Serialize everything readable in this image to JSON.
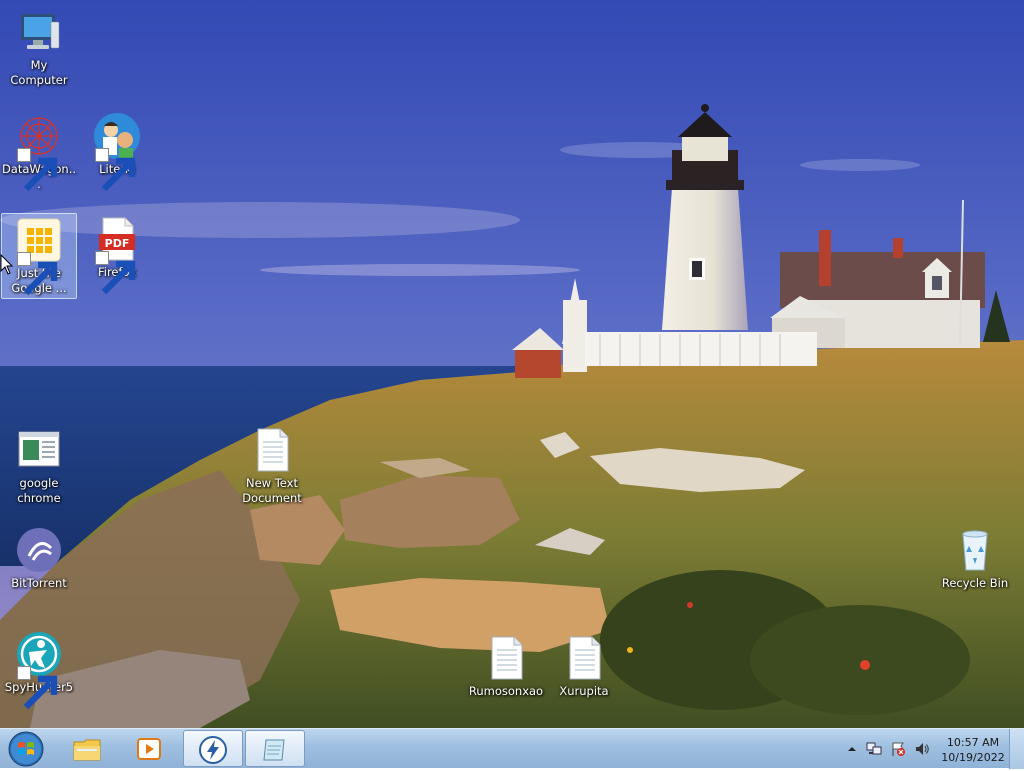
{
  "desktop": {
    "icons": [
      {
        "label": "My Computer"
      },
      {
        "label": "DataWagon..."
      },
      {
        "label": "Literki"
      },
      {
        "label": "Just the Google ..."
      },
      {
        "label": "Firefox"
      },
      {
        "label": "google chrome"
      },
      {
        "label": "New Text Document"
      },
      {
        "label": "BitTorrent"
      },
      {
        "label": "Recycle Bin"
      },
      {
        "label": "SpyHunter5"
      },
      {
        "label": "Rumosonxao"
      },
      {
        "label": "Xurupita"
      }
    ]
  },
  "taskbar": {
    "start_icon": "windows-logo-icon",
    "pinned": [
      {
        "icon": "folder-icon"
      },
      {
        "icon": "media-player-icon"
      },
      {
        "icon": "lightning-icon"
      },
      {
        "icon": "notepad-icon"
      }
    ],
    "tray": {
      "icons": [
        "show-hidden-icons",
        "network-icon",
        "flag-icon",
        "volume-icon"
      ],
      "time": "10:57 AM",
      "date": "10/19/2022"
    }
  },
  "colors": {
    "sky_top": "#3b54b8",
    "sky_bottom": "#8a86c8",
    "sea": "#1d3f86",
    "taskbar": "#a9c6e4"
  }
}
